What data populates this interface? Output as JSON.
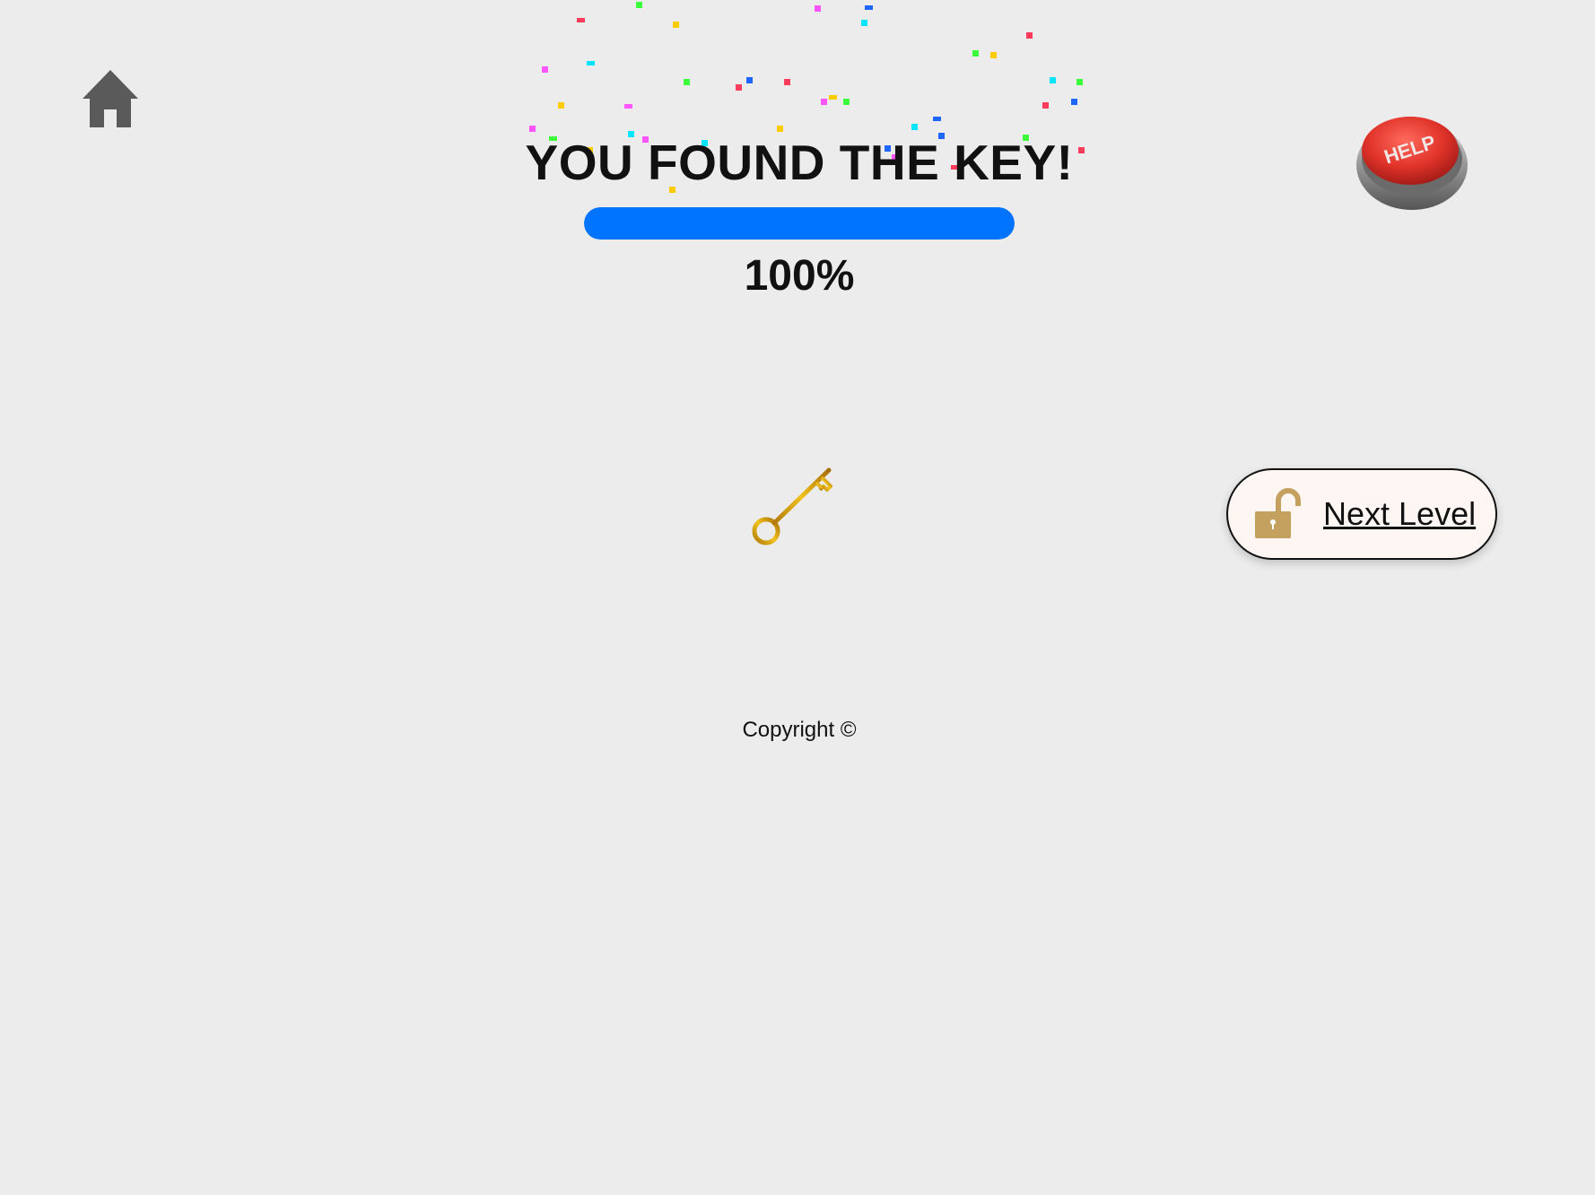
{
  "header": {
    "title": "YOU FOUND THE KEY!",
    "home_icon": "home-icon",
    "help_button_label": "HELP"
  },
  "progress": {
    "value": 1.0,
    "text": "100%",
    "color": "#0073ff"
  },
  "reward": {
    "icon": "golden-key-icon"
  },
  "next_level": {
    "icon": "unlocked-padlock-icon",
    "label": "Next Level"
  },
  "footer": {
    "copyright": "Copyright ©"
  },
  "colors": {
    "background": "#ececec",
    "help_red": "#e03a32",
    "key_gold": "#e8b01c",
    "lock_tan": "#c4a15f",
    "confetti": [
      "#ff3b5c",
      "#3bff3b",
      "#ffcc00",
      "#ff55ff",
      "#00e5ff",
      "#1e66ff"
    ]
  }
}
